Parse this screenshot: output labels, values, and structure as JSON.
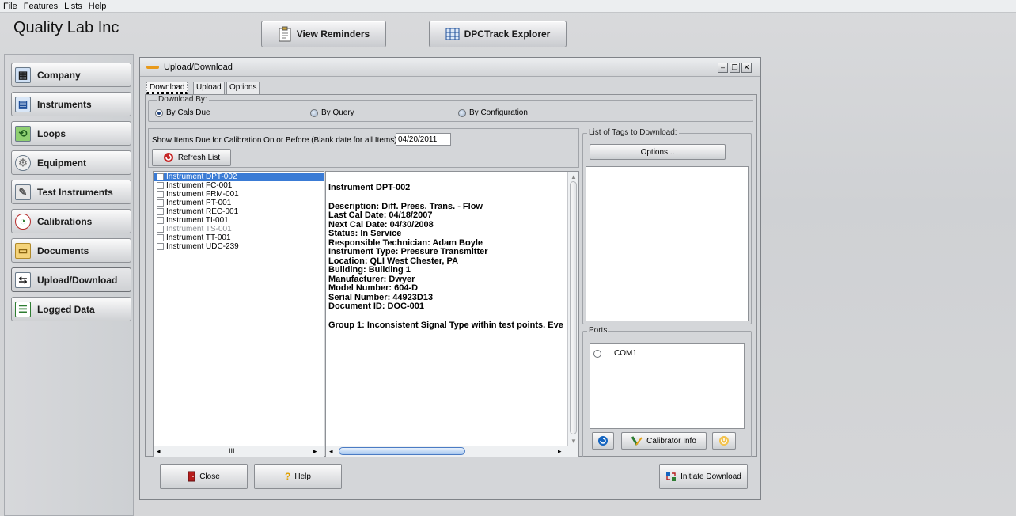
{
  "menu": [
    "File",
    "Features",
    "Lists",
    "Help"
  ],
  "app": {
    "title": "Quality Lab Inc"
  },
  "header_buttons": {
    "reminders": "View Reminders",
    "explorer": "DPCTrack Explorer"
  },
  "nav": [
    {
      "label": "Company",
      "icon": "building-icon"
    },
    {
      "label": "Instruments",
      "icon": "instruments-icon"
    },
    {
      "label": "Loops",
      "icon": "loops-icon"
    },
    {
      "label": "Equipment",
      "icon": "equipment-icon"
    },
    {
      "label": "Test Instruments",
      "icon": "test-instruments-icon"
    },
    {
      "label": "Calibrations",
      "icon": "gauge-icon"
    },
    {
      "label": "Documents",
      "icon": "folder-icon"
    },
    {
      "label": "Upload/Download",
      "icon": "upload-download-icon"
    },
    {
      "label": "Logged Data",
      "icon": "logged-data-icon"
    }
  ],
  "window": {
    "title": "Upload/Download",
    "tabs": [
      "Download",
      "Upload",
      "Options"
    ],
    "download_by": {
      "label": "Download By:",
      "options": [
        "By Cals Due",
        "By Query",
        "By Configuration"
      ],
      "selected": "By Cals Due"
    },
    "due_label": "Show Items Due for Calibration On or Before (Blank date for all Items)",
    "due_date": "04/20/2011",
    "refresh_label": "Refresh List",
    "instruments": [
      {
        "name": "Instrument DPT-002",
        "selected": true,
        "dim": false
      },
      {
        "name": "Instrument FC-001",
        "selected": false,
        "dim": false
      },
      {
        "name": "Instrument FRM-001",
        "selected": false,
        "dim": false
      },
      {
        "name": "Instrument PT-001",
        "selected": false,
        "dim": false
      },
      {
        "name": "Instrument REC-001",
        "selected": false,
        "dim": false
      },
      {
        "name": "Instrument TI-001",
        "selected": false,
        "dim": false
      },
      {
        "name": "Instrument TS-001",
        "selected": false,
        "dim": true
      },
      {
        "name": "Instrument TT-001",
        "selected": false,
        "dim": false
      },
      {
        "name": "Instrument UDC-239",
        "selected": false,
        "dim": false
      }
    ],
    "details": {
      "heading": "Instrument DPT-002",
      "lines": [
        "Description: Diff. Press. Trans. - Flow",
        "Last Cal Date: 04/18/2007",
        "Next Cal Date: 04/30/2008",
        "Status: In Service",
        "Responsible Technician: Adam Boyle",
        "Instrument Type: Pressure Transmitter",
        "Location: QLI West Chester, PA",
        "Building: Building 1",
        "Manufacturer: Dwyer",
        "Model Number: 604-D",
        "Serial Number: 44923D13",
        "Document ID: DOC-001"
      ],
      "group_note": "Group 1: Inconsistent Signal Type within test points. Eve"
    },
    "tags_label": "List of Tags to Download:",
    "tags_options": "Options...",
    "ports_label": "Ports",
    "ports": [
      "COM1"
    ],
    "calibrator_info": "Calibrator Info",
    "close": "Close",
    "help": "Help",
    "initiate": "Initiate Download"
  }
}
